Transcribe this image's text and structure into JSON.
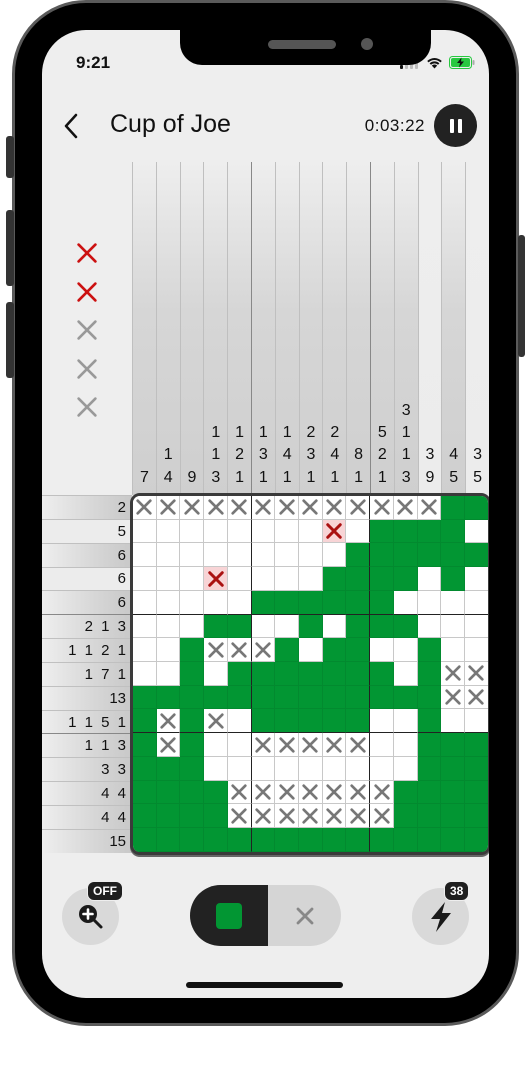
{
  "status_bar": {
    "time": "9:21",
    "signal_icon": "cellular-signal-icon",
    "wifi_icon": "wifi-icon",
    "battery_icon": "battery-charging-icon"
  },
  "header": {
    "back_icon": "chevron-left-icon",
    "title": "Cup of Joe",
    "timer": "0:03:22",
    "pause_icon": "pause-icon"
  },
  "lives": {
    "total": 5,
    "used": 2,
    "used_color": "#cc1111",
    "unused_color": "#999999"
  },
  "colors": {
    "fill": "#029633",
    "error_bg": "#f8d4d6",
    "error_x": "#aa1111",
    "mark_x": "#777777"
  },
  "column_clues": [
    {
      "nums": [
        "7"
      ],
      "done": false
    },
    {
      "nums": [
        "1",
        "4"
      ],
      "done": false
    },
    {
      "nums": [
        "9"
      ],
      "done": false
    },
    {
      "nums": [
        "1",
        "1",
        "3"
      ],
      "done": false
    },
    {
      "nums": [
        "1",
        "2",
        "1"
      ],
      "done": false
    },
    {
      "nums": [
        "1",
        "3",
        "1"
      ],
      "done": false
    },
    {
      "nums": [
        "1",
        "4",
        "1"
      ],
      "done": false
    },
    {
      "nums": [
        "2",
        "3",
        "1"
      ],
      "done": false
    },
    {
      "nums": [
        "2",
        "4",
        "1"
      ],
      "done": false
    },
    {
      "nums": [
        "8",
        "1"
      ],
      "done": false
    },
    {
      "nums": [
        "5",
        "2",
        "1"
      ],
      "done": false
    },
    {
      "nums": [
        "3",
        "1",
        "1",
        "3"
      ],
      "done": false
    },
    {
      "nums": [
        "3",
        "9"
      ],
      "done": true
    },
    {
      "nums": [
        "4",
        "5"
      ],
      "done": false
    },
    {
      "nums": [
        "3",
        "5"
      ],
      "done": true
    }
  ],
  "row_clues": [
    {
      "text": "2",
      "done": false
    },
    {
      "text": "5",
      "done": true
    },
    {
      "text": "6",
      "done": false
    },
    {
      "text": "6",
      "done": true
    },
    {
      "text": "6",
      "done": false
    },
    {
      "text": "2 1 3",
      "done": false
    },
    {
      "text": "1 1 2 1",
      "done": false
    },
    {
      "text": "1 7 1",
      "done": false
    },
    {
      "text": "13",
      "done": false
    },
    {
      "text": "1 1 5 1",
      "done": false
    },
    {
      "text": "1 1 3",
      "done": false
    },
    {
      "text": "3 3",
      "done": false
    },
    {
      "text": "4 4",
      "done": false
    },
    {
      "text": "4 4",
      "done": false
    },
    {
      "text": "15",
      "done": false
    }
  ],
  "grid_legend": {
    "#": "filled",
    "x": "marked-empty",
    "r": "error-x",
    ".": "blank"
  },
  "grid": [
    "xxxxxxxxxxxxx##",
    "........r.####.",
    ".........######",
    "...r....####.#.",
    ".....######....",
    "...##..#.###...",
    "..#xxx#.##..#..",
    "..#.#######.#xx",
    "#############xx",
    "#x#x.#####..#..",
    "#x#..xxxxx..###",
    "###.........###",
    "####xxxxxxx####",
    "####xxxxxxx####",
    "###############"
  ],
  "toolbar": {
    "zoom_icon": "zoom-in-icon",
    "zoom_badge": "OFF",
    "mode_fill_icon": "fill-square-icon",
    "mode_cross_icon": "cross-mark-icon",
    "hint_icon": "lightning-bolt-icon",
    "hint_badge": "38"
  }
}
